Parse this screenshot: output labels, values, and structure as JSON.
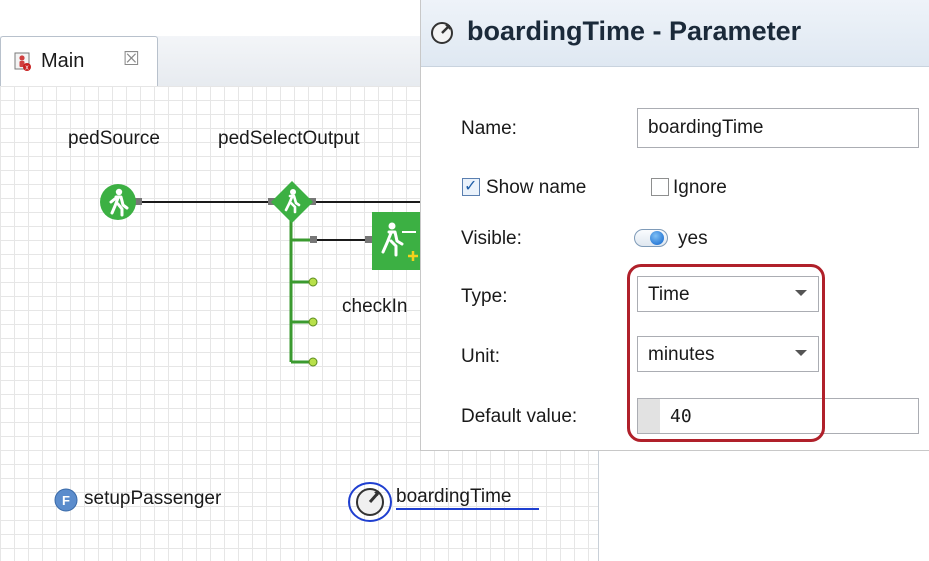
{
  "editor": {
    "tab": {
      "label": "Main",
      "close_glyph": "☒",
      "icon": "agent-icon"
    },
    "blocks": {
      "ped_source": {
        "label": "pedSource",
        "icon": "pedestrian-source-icon"
      },
      "ped_select_output": {
        "label": "pedSelectOutput",
        "icon": "pedestrian-select-output-icon"
      },
      "check_in": {
        "label": "checkIn",
        "icon": "pedestrian-service-icon"
      }
    },
    "function": {
      "label": "setupPassenger",
      "glyph": "F",
      "icon": "function-icon"
    },
    "parameter": {
      "label": "boardingTime",
      "icon": "parameter-icon"
    }
  },
  "properties": {
    "title": "boardingTime - Parameter",
    "name_label": "Name:",
    "name_value": "boardingTime",
    "show_name_label": "Show name",
    "show_name_checked": true,
    "ignore_label": "Ignore",
    "ignore_checked": false,
    "visible_label": "Visible:",
    "visible_value": "yes",
    "type_label": "Type:",
    "type_value": "Time",
    "unit_label": "Unit:",
    "unit_value": "minutes",
    "default_label": "Default value:",
    "default_value": "40",
    "check_glyph": "✓"
  },
  "colors": {
    "block_green": "#3cb043",
    "highlight": "#b0202a",
    "link_blue": "#1f3fd0"
  }
}
